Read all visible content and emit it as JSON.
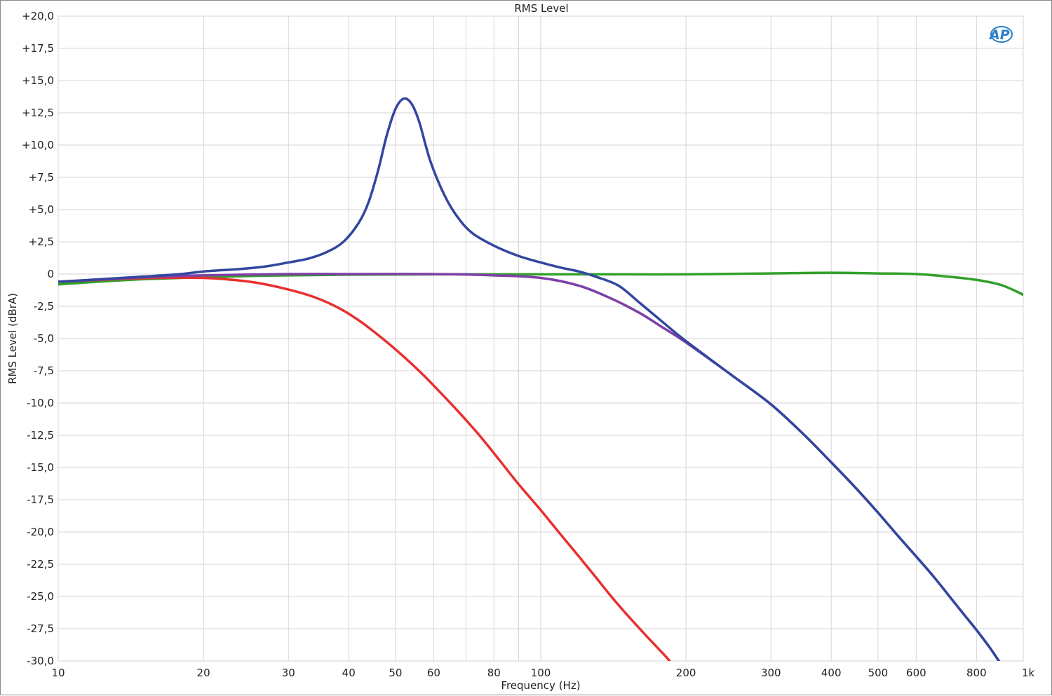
{
  "chart_data": {
    "type": "line",
    "title": "RMS Level",
    "xlabel": "Frequency (Hz)",
    "ylabel": "RMS Level (dBrA)",
    "xscale": "log",
    "xlim": [
      10,
      1000
    ],
    "ylim": [
      -30,
      20
    ],
    "grid": true,
    "logo": "AP",
    "x_ticks": [
      {
        "value": 10,
        "label": "10"
      },
      {
        "value": 20,
        "label": "20"
      },
      {
        "value": 30,
        "label": "30"
      },
      {
        "value": 40,
        "label": "40"
      },
      {
        "value": 50,
        "label": "50"
      },
      {
        "value": 60,
        "label": "60"
      },
      {
        "value": 80,
        "label": "80"
      },
      {
        "value": 100,
        "label": "100"
      },
      {
        "value": 200,
        "label": "200"
      },
      {
        "value": 300,
        "label": "300"
      },
      {
        "value": 400,
        "label": "400"
      },
      {
        "value": 500,
        "label": "500"
      },
      {
        "value": 600,
        "label": "600"
      },
      {
        "value": 800,
        "label": "800"
      },
      {
        "value": 1000,
        "label": "1k"
      }
    ],
    "x_minor_grid": [
      70,
      90
    ],
    "y_ticks": [
      {
        "value": 20,
        "label": "+20,0"
      },
      {
        "value": 17.5,
        "label": "+17,5"
      },
      {
        "value": 15,
        "label": "+15,0"
      },
      {
        "value": 12.5,
        "label": "+12,5"
      },
      {
        "value": 10,
        "label": "+10,0"
      },
      {
        "value": 7.5,
        "label": "+7,5"
      },
      {
        "value": 5,
        "label": "+5,0"
      },
      {
        "value": 2.5,
        "label": "+2,5"
      },
      {
        "value": 0,
        "label": "0"
      },
      {
        "value": -2.5,
        "label": "-2,5"
      },
      {
        "value": -5,
        "label": "-5,0"
      },
      {
        "value": -7.5,
        "label": "-7,5"
      },
      {
        "value": -10,
        "label": "-10,0"
      },
      {
        "value": -12.5,
        "label": "-12,5"
      },
      {
        "value": -15,
        "label": "-15,0"
      },
      {
        "value": -17.5,
        "label": "-17,5"
      },
      {
        "value": -20,
        "label": "-20,0"
      },
      {
        "value": -22.5,
        "label": "-22,5"
      },
      {
        "value": -25,
        "label": "-25,0"
      },
      {
        "value": -27.5,
        "label": "-27,5"
      },
      {
        "value": -30,
        "label": "-30,0"
      }
    ],
    "series": [
      {
        "color": "#32a02a",
        "points": [
          [
            10,
            -0.8
          ],
          [
            12,
            -0.6
          ],
          [
            15,
            -0.4
          ],
          [
            20,
            -0.25
          ],
          [
            25,
            -0.15
          ],
          [
            30,
            -0.1
          ],
          [
            40,
            -0.05
          ],
          [
            60,
            -0.02
          ],
          [
            100,
            -0.02
          ],
          [
            150,
            -0.02
          ],
          [
            200,
            -0.02
          ],
          [
            300,
            0.05
          ],
          [
            400,
            0.1
          ],
          [
            500,
            0.05
          ],
          [
            600,
            0
          ],
          [
            700,
            -0.2
          ],
          [
            800,
            -0.45
          ],
          [
            900,
            -0.85
          ],
          [
            1000,
            -1.6
          ]
        ]
      },
      {
        "color": "#e83030",
        "points": [
          [
            10,
            -0.6
          ],
          [
            13,
            -0.4
          ],
          [
            16,
            -0.3
          ],
          [
            20,
            -0.3
          ],
          [
            23,
            -0.45
          ],
          [
            26,
            -0.7
          ],
          [
            30,
            -1.2
          ],
          [
            34,
            -1.8
          ],
          [
            38,
            -2.6
          ],
          [
            42,
            -3.6
          ],
          [
            47,
            -5.0
          ],
          [
            52,
            -6.4
          ],
          [
            57,
            -7.8
          ],
          [
            62,
            -9.2
          ],
          [
            68,
            -10.8
          ],
          [
            75,
            -12.6
          ],
          [
            82,
            -14.4
          ],
          [
            90,
            -16.3
          ],
          [
            100,
            -18.3
          ],
          [
            110,
            -20.2
          ],
          [
            120,
            -21.9
          ],
          [
            130,
            -23.5
          ],
          [
            140,
            -25.0
          ],
          [
            150,
            -26.3
          ],
          [
            165,
            -28.0
          ],
          [
            180,
            -29.5
          ],
          [
            185,
            -30.0
          ]
        ]
      },
      {
        "color": "#7e3fa8",
        "points": [
          [
            10,
            -0.6
          ],
          [
            15,
            -0.25
          ],
          [
            20,
            -0.1
          ],
          [
            30,
            0
          ],
          [
            40,
            0
          ],
          [
            60,
            0
          ],
          [
            80,
            -0.1
          ],
          [
            100,
            -0.3
          ],
          [
            120,
            -0.9
          ],
          [
            140,
            -1.9
          ],
          [
            160,
            -3.0
          ],
          [
            180,
            -4.2
          ],
          [
            200,
            -5.3
          ],
          [
            250,
            -7.9
          ],
          [
            300,
            -10.1
          ],
          [
            350,
            -12.4
          ],
          [
            400,
            -14.6
          ],
          [
            450,
            -16.6
          ],
          [
            500,
            -18.5
          ],
          [
            550,
            -20.3
          ],
          [
            600,
            -21.9
          ],
          [
            650,
            -23.4
          ],
          [
            700,
            -24.9
          ],
          [
            750,
            -26.3
          ],
          [
            800,
            -27.6
          ],
          [
            850,
            -28.9
          ],
          [
            890,
            -30.0
          ]
        ]
      },
      {
        "color": "#33469f",
        "points": [
          [
            10,
            -0.6
          ],
          [
            15,
            -0.2
          ],
          [
            18,
            0
          ],
          [
            20,
            0.2
          ],
          [
            24,
            0.4
          ],
          [
            27,
            0.6
          ],
          [
            30,
            0.9
          ],
          [
            33,
            1.2
          ],
          [
            36,
            1.7
          ],
          [
            39,
            2.5
          ],
          [
            42,
            4.0
          ],
          [
            44,
            5.6
          ],
          [
            46,
            8.0
          ],
          [
            48,
            10.8
          ],
          [
            50,
            12.8
          ],
          [
            52,
            13.6
          ],
          [
            54,
            13.2
          ],
          [
            56,
            11.8
          ],
          [
            59,
            8.8
          ],
          [
            63,
            6.2
          ],
          [
            67,
            4.5
          ],
          [
            72,
            3.2
          ],
          [
            80,
            2.2
          ],
          [
            90,
            1.4
          ],
          [
            100,
            0.9
          ],
          [
            110,
            0.5
          ],
          [
            120,
            0.2
          ],
          [
            130,
            -0.2
          ],
          [
            145,
            -0.9
          ],
          [
            160,
            -2.2
          ],
          [
            180,
            -3.8
          ],
          [
            200,
            -5.2
          ],
          [
            250,
            -7.9
          ],
          [
            300,
            -10.1
          ],
          [
            350,
            -12.4
          ],
          [
            400,
            -14.6
          ],
          [
            450,
            -16.6
          ],
          [
            500,
            -18.5
          ],
          [
            550,
            -20.3
          ],
          [
            600,
            -21.9
          ],
          [
            650,
            -23.4
          ],
          [
            700,
            -24.9
          ],
          [
            750,
            -26.3
          ],
          [
            800,
            -27.6
          ],
          [
            850,
            -28.9
          ],
          [
            890,
            -30.0
          ]
        ]
      }
    ]
  }
}
